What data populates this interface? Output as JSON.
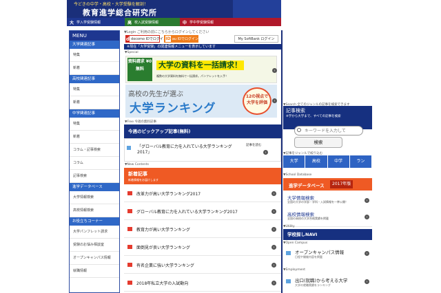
{
  "header": {
    "tagline": "今どきの中学・高校・大学受験を解剖！",
    "title": "教育進学総合研究所",
    "nav": [
      {
        "num": "大",
        "label": "学入学受験情報",
        "color": "#1e3790"
      },
      {
        "num": "高",
        "label": "校入試受験情報",
        "color": "#2b7a2f"
      },
      {
        "num": "中",
        "label": "学中学受験情報",
        "color": "#b0182a"
      }
    ]
  },
  "menu": {
    "title": "MENU",
    "sections": [
      {
        "category": "大学関連記事",
        "items": [
          "特集",
          "新着"
        ]
      },
      {
        "category": "高校関連記事",
        "items": [
          "特集",
          "新着"
        ]
      },
      {
        "category": "中学関連記事",
        "items": [
          "特集",
          "新着",
          "コラム・記事検索",
          "コラム",
          "記事検索"
        ]
      },
      {
        "category": "進学データベース",
        "items": [
          "大学情報検索",
          "高校情報検索"
        ]
      },
      {
        "category": "お役立ちコーナー",
        "items": [
          "大学パンフレット請求",
          "受験のお悩み相談室",
          "オープンキャンパス情報",
          "就職情報"
        ]
      }
    ]
  },
  "login": {
    "label": "▼Login ご利用の前にこちらからログインしてください",
    "docomo": "docomo IDでログイン",
    "au": "au IDでログイン",
    "softbank": "My SoftBank ログイン"
  },
  "notice": "※現在「大学受験」の関連情報メニューを表示しています",
  "special_label": "▼Special",
  "banner1": {
    "left": "資料請求 ¥0 無料",
    "title": "大学の資料を一括請求！",
    "sub": "複数の大学資料を無料で一括請求。パンフレットを入手！"
  },
  "banner2": {
    "line1": "高校の先生が選ぶ",
    "line2": "大学ランキング",
    "badge": "12の視点で大学を評価"
  },
  "pickup": {
    "label": "▼Free 今週の無料記事",
    "title": "今週のピックアップ記事(無料)",
    "article": "「グローバル教育に力を入れている大学ランキング2017」",
    "button": "記事を読む"
  },
  "new_contents": {
    "label": "▼New Contents",
    "title": "新着記事",
    "subtitle": "新着情報をお届けします",
    "articles": [
      "改革力が高い大学ランキング2017",
      "グローバル教育に力を入れている大学ランキング2017",
      "教育力が高い大学ランキング",
      "面倒見が良い大学ランキング",
      "有名企業に強い大学ランキング",
      "2018年私立大学の入試動向"
    ]
  },
  "search": {
    "label": "▼Search 全てのジャンルの記事を検索できます",
    "title": "記事検索",
    "subtitle": "※学から大学まで、すべての記事を検索",
    "placeholder": "キーワードを入力して",
    "button": "検索",
    "genre_label": "▼記事をジャンルで絞り込む",
    "categories": [
      "大学",
      "高校",
      "中学",
      "ラン"
    ]
  },
  "database": {
    "label": "▼School Database",
    "title": "進学データベース",
    "year": "2017年版",
    "items": [
      {
        "title": "大学情報検索",
        "sub": "全国の大学の学部・学科・入試情報を一挙公開！"
      },
      {
        "title": "高校情報検索",
        "sub": "全国の高校の大学合格実績を掲載"
      }
    ]
  },
  "utility": {
    "label": "▼Utility",
    "title": "学校探しNAVI",
    "open_label": "▼Open Campus",
    "open_title": "オープンキャンパス情報",
    "open_sub": "日程や開催内容を掲載",
    "emp_label": "▼Employment",
    "emp_title": "出口(就職)から考える大学",
    "emp_sub": "大学の就職実績をランキング"
  }
}
